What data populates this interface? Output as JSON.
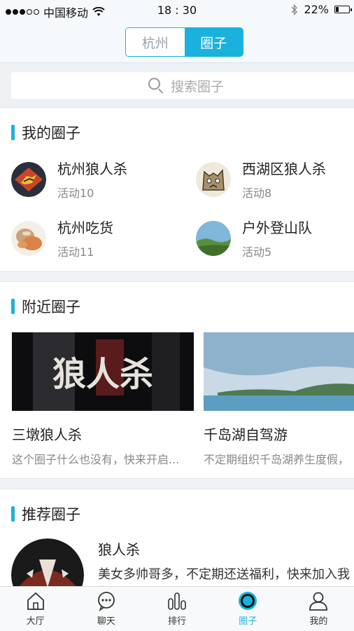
{
  "status": {
    "carrier": "中国移动",
    "time": "18 : 30",
    "battery": "22%",
    "battery_level": 0.22,
    "signal_bars": 3
  },
  "header": {
    "tabs": [
      {
        "label": "杭州",
        "active": false
      },
      {
        "label": "圈子",
        "active": true
      }
    ]
  },
  "search": {
    "placeholder": "搜索圈子"
  },
  "my_circles": {
    "title": "我的圈子",
    "items": [
      {
        "name": "杭州狼人杀",
        "sub": "活动10",
        "icon": "werewolf-logo-avatar"
      },
      {
        "name": "西湖区狼人杀",
        "sub": "活动8",
        "icon": "wolf-cartoon-avatar"
      },
      {
        "name": "杭州吃货",
        "sub": "活动11",
        "icon": "food-avatar"
      },
      {
        "name": "户外登山队",
        "sub": "活动5",
        "icon": "mountain-avatar"
      }
    ]
  },
  "nearby": {
    "title": "附近圈子",
    "items": [
      {
        "name": "三墩狼人杀",
        "desc": "这个圈子什么也没有，快来开启...",
        "image_text": "狼人杀"
      },
      {
        "name": "千岛湖自驾游",
        "desc": "不定期组织千岛湖养生度假，"
      }
    ]
  },
  "recommend": {
    "title": "推荐圈子",
    "items": [
      {
        "name": "狼人杀",
        "desc": "美女多帅哥多，不定期还送福利，快来加入我们吧"
      }
    ]
  },
  "tabbar": [
    {
      "label": "大厅",
      "icon": "home-icon",
      "active": false
    },
    {
      "label": "聊天",
      "icon": "chat-icon",
      "active": false
    },
    {
      "label": "排行",
      "icon": "ranking-icon",
      "active": false
    },
    {
      "label": "圈子",
      "icon": "circle-icon",
      "active": true
    },
    {
      "label": "我的",
      "icon": "profile-icon",
      "active": false
    }
  ],
  "colors": {
    "accent": "#1ab2dc"
  }
}
